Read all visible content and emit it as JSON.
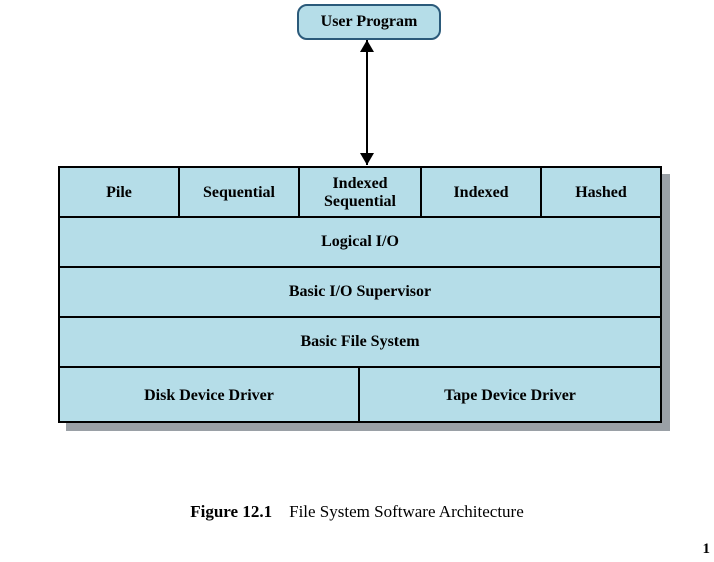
{
  "top_box": {
    "label": "User Program"
  },
  "rows": {
    "access_methods": {
      "pile": "Pile",
      "sequential": "Sequential",
      "indexed_sequential_line1": "Indexed",
      "indexed_sequential_line2": "Sequential",
      "indexed": "Indexed",
      "hashed": "Hashed"
    },
    "logical_io": "Logical I/O",
    "basic_io_supervisor": "Basic I/O Supervisor",
    "basic_file_system": "Basic File System",
    "drivers": {
      "disk": "Disk Device Driver",
      "tape": "Tape Device Driver"
    }
  },
  "caption": {
    "label": "Figure 12.1",
    "title": "File System Software Architecture"
  },
  "page_number": "1"
}
